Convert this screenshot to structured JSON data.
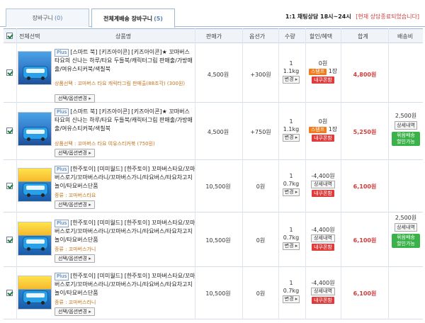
{
  "tabs": [
    {
      "label": "장바구니",
      "count": "(0)"
    },
    {
      "label": "전체계배송 장바구니",
      "count": "(5)"
    }
  ],
  "consult": {
    "prefix": "1:1",
    "label": "채팅상담 18시~24시",
    "status": "[현재 상담종료되었습니다]"
  },
  "header": {
    "select_all": "전체선택",
    "product": "상품명",
    "price": "판매가",
    "option_price": "옵션가",
    "qty": "수량",
    "discount": "할인/혜택",
    "total": "합계",
    "shipping": "배송비"
  },
  "rows": [
    {
      "plus": "Plus",
      "name": "[스마트 북] [키즈아이콘] [키즈아이콘]★ 꼬마버스 타요의 신나는 하루/타요 두들북/캐릭터그림 판매출/가방매출/여유스티커북/색칠북",
      "option": "상품선택 : 꼬마버스 타요 캐릭터그림 판매출(88조각) (300원)",
      "option_button": "선택/옵션변경",
      "price": "4,500원",
      "option_price": "+300원",
      "qty": "1",
      "weight": "1.1kg",
      "qty_button": "변경",
      "discount": "0원",
      "stamp": "스탬프",
      "stamp_count": "1장",
      "coupon": "내쿠폰함",
      "total": "4,800원"
    },
    {
      "plus": "Plus",
      "name": "[스마트 북] [키즈아이콘] [키즈아이콘]★ 꼬마버스 타요의 신나는 하루/타요 두들북/캐릭터그림 판매출/가방매출/여유스티커북/색칠북",
      "option": "상품선택 : 꼬마버스 타요 여유스티커북 (750원)",
      "option_button": "선택/옵션변경",
      "price": "4,500원",
      "option_price": "+750원",
      "qty": "1",
      "weight": "1.1kg",
      "qty_button": "변경",
      "discount": "0원",
      "stamp": "스탬프",
      "stamp_count": "1장",
      "coupon": "내쿠폰함",
      "total": "5,250원"
    },
    {
      "plus": "Plus",
      "name": "[한주토이] [미미월드] [한주토이] 꼬마버스타요/꼬마버스로기/꼬마버스라니/꼬마버스가니/타요버스/타요차고지놀이/타요버스단품",
      "option": "종류 : 꼬마버스타요",
      "option_button": "선택/옵션변경",
      "price": "10,500원",
      "option_price": "0원",
      "qty": "1",
      "weight": "0.7kg",
      "qty_button": "변경",
      "discount": "-4,400원",
      "detail": "상세내역",
      "coupon": "내쿠폰함",
      "total": "6,100원"
    },
    {
      "plus": "Plus",
      "name": "[한주토이] [미미월드] [한주토이] 꼬마버스타요/꼬마버스로기/꼬마버스라니/꼬마버스가니/타요버스/타요차고지놀이/타요버스단품",
      "option": "종류 : 꼬마버스가니",
      "option_button": "선택/옵션변경",
      "price": "10,500원",
      "option_price": "0원",
      "qty": "1",
      "weight": "0.7kg",
      "qty_button": "변경",
      "discount": "-4,400원",
      "detail": "상세내역",
      "coupon": "내쿠폰함",
      "total": "6,100원"
    },
    {
      "plus": "Plus",
      "name": "[한주토이] [미미월드] [한주토이] 꼬마버스타요/꼬마버스로기/꼬마버스라니/꼬마버스가니/타요버스/타요차고지놀이/타요버스단품",
      "option": "종류 : 꼬마버스라니",
      "option_button": "선택/옵션변경",
      "price": "10,500원",
      "option_price": "0원",
      "qty": "1",
      "weight": "0.7kg",
      "qty_button": "변경",
      "discount": "-4,400원",
      "detail": "상세내역",
      "coupon": "내쿠폰함",
      "total": "6,100원"
    }
  ],
  "shipping_groups": [
    {
      "fee": "2,500원",
      "detail": "상세내역",
      "free_line1": "묶음배송",
      "free_line2": "할인가능"
    },
    {
      "fee": "2,500원",
      "detail": "상세내역",
      "free_line1": "묶음배송",
      "free_line2": "할인가능"
    }
  ]
}
